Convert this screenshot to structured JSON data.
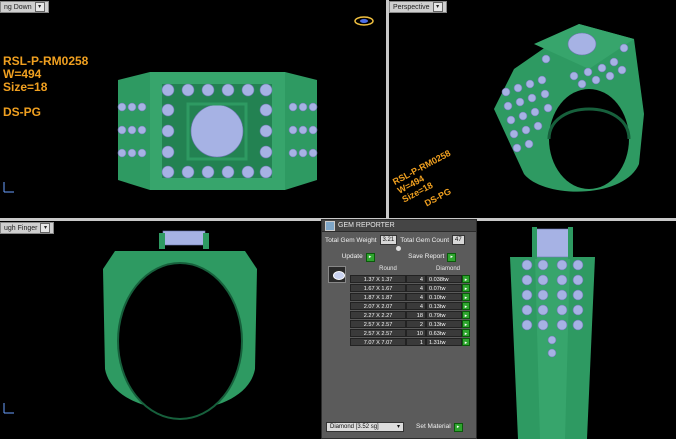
{
  "viewports": {
    "top": {
      "label": "ng Down"
    },
    "perspective": {
      "label": "Perspective"
    },
    "front": {
      "label": "ugh Finger"
    }
  },
  "ring_info": {
    "code": "RSL-P-RM0258",
    "weight": "W=494",
    "size": "Size=18",
    "type": "DS-PG"
  },
  "gem_reporter": {
    "title": "GEM REPORTER",
    "total_weight_label": "Total Gem Weight",
    "total_weight_value": "3.21",
    "total_count_label": "Total Gem Count",
    "total_count_value": "47",
    "update_label": "Update",
    "save_report_label": "Save Report",
    "col_shape": "Round",
    "col_material": "Diamond",
    "rows": [
      {
        "size": "1.37 X 1.37",
        "count": "4",
        "ctw": "0.038tw"
      },
      {
        "size": "1.67 X 1.67",
        "count": "4",
        "ctw": "0.07tw"
      },
      {
        "size": "1.87 X 1.87",
        "count": "4",
        "ctw": "0.10tw"
      },
      {
        "size": "2.07 X 2.07",
        "count": "4",
        "ctw": "0.13tw"
      },
      {
        "size": "2.27 X 2.27",
        "count": "18",
        "ctw": "0.79tw"
      },
      {
        "size": "2.57 X 2.57",
        "count": "2",
        "ctw": "0.13tw"
      },
      {
        "size": "2.57 X 2.57",
        "count": "10",
        "ctw": "0.63tw"
      },
      {
        "size": "7.07 X 7.07",
        "count": "1",
        "ctw": "1.31tw"
      }
    ],
    "material_select": "Diamond",
    "material_sg": "[3.52 sg]",
    "set_material_label": "Set Material"
  },
  "colors": {
    "metal": "#2e9a62",
    "metal_dark": "#17603c",
    "gem": "#a6b2e4",
    "label_orange": "#f0a020"
  }
}
